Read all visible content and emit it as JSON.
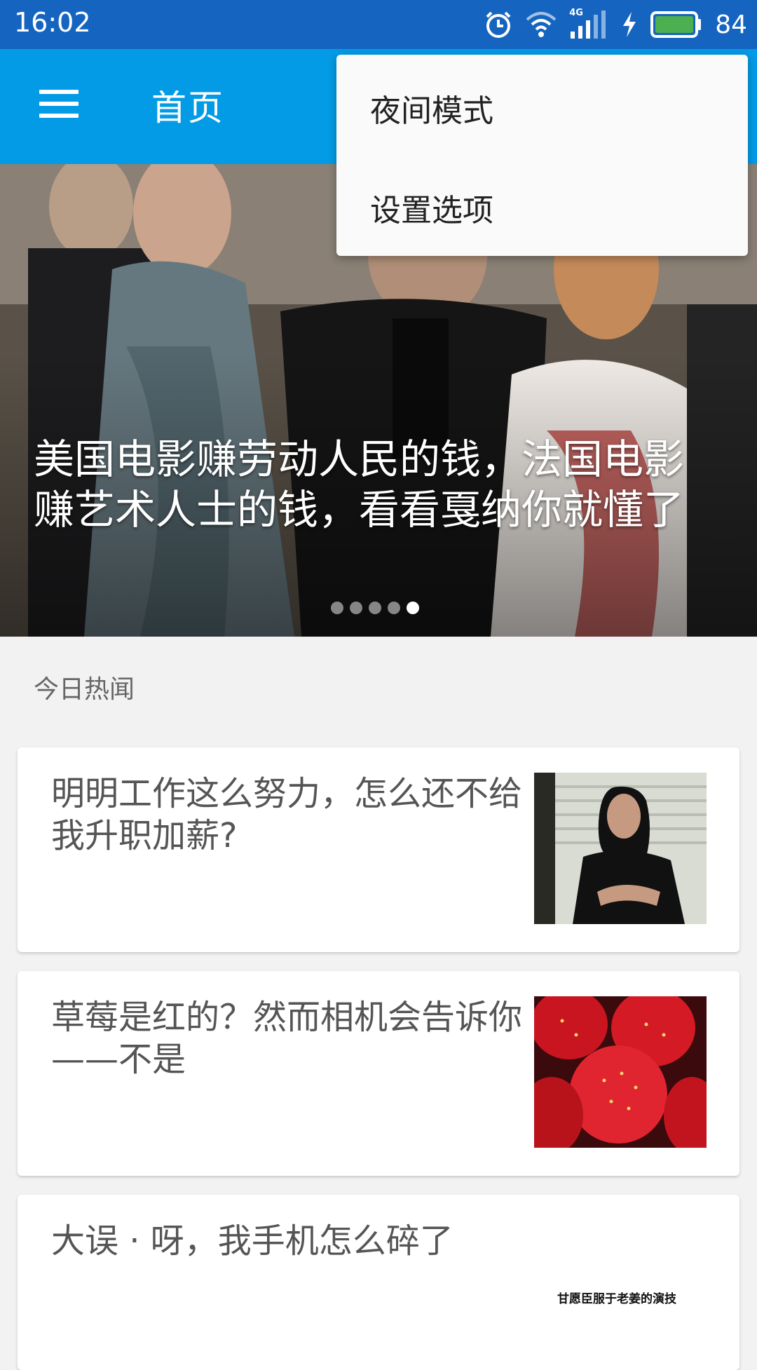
{
  "status_bar": {
    "time": "16:02",
    "battery_level": "84",
    "network": "4G",
    "icons": [
      "alarm-icon",
      "wifi-icon",
      "signal-icon",
      "charging-icon",
      "battery-icon"
    ]
  },
  "app_bar": {
    "title": "首页",
    "menu_icon": "hamburger-menu-icon",
    "color": "#039be5"
  },
  "dropdown_menu": {
    "items": [
      {
        "label": "夜间模式"
      },
      {
        "label": "设置选项"
      }
    ]
  },
  "hero": {
    "title": "美国电影赚劳动人民的钱，法国电影赚艺术人士的钱，看看戛纳你就懂了",
    "page_count": 5,
    "active_page": 5
  },
  "section": {
    "title": "今日热闻"
  },
  "news": [
    {
      "title": "明明工作这么努力，怎么还不给我升职加薪?"
    },
    {
      "title": "草莓是红的？然而相机会告诉你——不是"
    },
    {
      "title": "大误 · 呀，我手机怎么碎了",
      "thumb_caption": "甘愿臣服于老姜的演技"
    }
  ]
}
